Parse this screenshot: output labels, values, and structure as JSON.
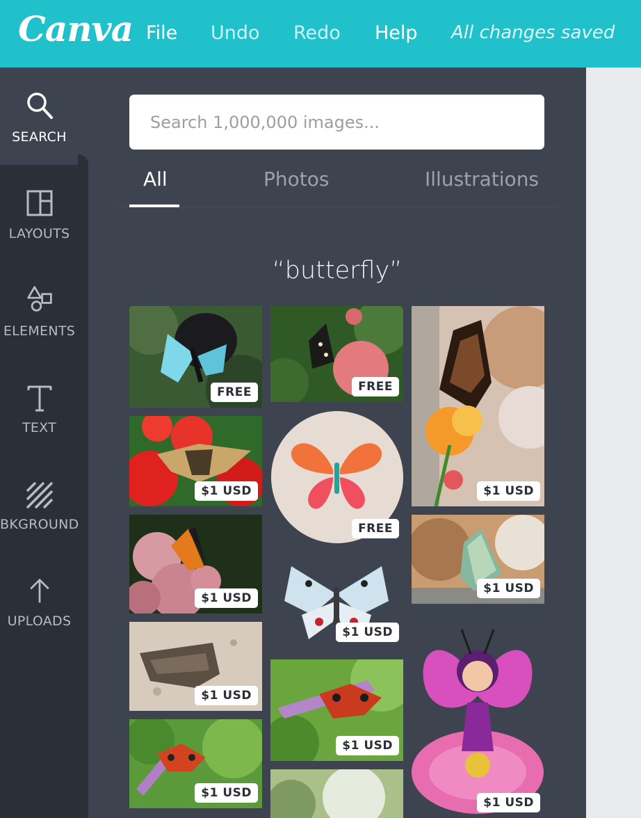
{
  "topbar": {
    "logo": "Canva",
    "menu": [
      "File",
      "Undo",
      "Redo",
      "Help"
    ],
    "status": "All changes saved"
  },
  "rail": {
    "items": [
      {
        "label": "SEARCH",
        "icon": "search-icon"
      },
      {
        "label": "LAYOUTS",
        "icon": "layouts-icon"
      },
      {
        "label": "ELEMENTS",
        "icon": "elements-icon"
      },
      {
        "label": "TEXT",
        "icon": "text-icon"
      },
      {
        "label": "BKGROUND",
        "icon": "background-icon"
      },
      {
        "label": "UPLOADS",
        "icon": "upload-arrow-icon"
      }
    ]
  },
  "search": {
    "placeholder": "Search 1,000,000 images...",
    "value": ""
  },
  "tabs": [
    "All",
    "Photos",
    "Illustrations"
  ],
  "active_tab": "All",
  "query_heading": "“butterfly”",
  "results": [
    {
      "subject": "blue swallowtail butterfly",
      "price": "FREE"
    },
    {
      "subject": "dark butterfly on pink flower",
      "price": "FREE"
    },
    {
      "subject": "monarch-like butterfly on orange flowers",
      "price": "$1 USD"
    },
    {
      "subject": "butterfly on red flowers",
      "price": "$1 USD"
    },
    {
      "subject": "illustrated orange butterfly in circle",
      "price": "FREE"
    },
    {
      "subject": "monarch butterfly on pink sedum",
      "price": "$1 USD"
    },
    {
      "subject": "green butterfly on rock",
      "price": "$1 USD"
    },
    {
      "subject": "apollo butterfly",
      "price": "$1 USD"
    },
    {
      "subject": "brown moth on sand",
      "price": "$1 USD"
    },
    {
      "subject": "fairy on pink flower illustration",
      "price": "$1 USD"
    },
    {
      "subject": "peacock butterfly on lilac",
      "price": "$1 USD"
    },
    {
      "subject": "peacock butterfly on lilac",
      "price": "$1 USD"
    },
    {
      "subject": "blurred green photo",
      "price": ""
    }
  ],
  "colors": {
    "brand": "#21c1cc",
    "panel": "#3e4350",
    "rail": "#2b2f37"
  }
}
